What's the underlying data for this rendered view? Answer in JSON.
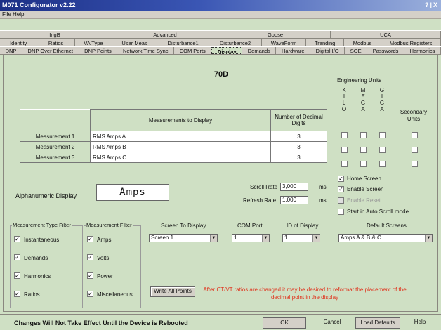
{
  "window": {
    "title": "M071 Configurator v2.22",
    "controls": "?|X"
  },
  "menu": [
    "File",
    "Help"
  ],
  "tabs_row1": [
    "IrigB",
    "Advanced",
    "Goose",
    "UCA"
  ],
  "tabs_row2": [
    "Identity",
    "Ratios",
    "VA Type",
    "User Meas",
    "Disturbance1",
    "Disturbance2",
    "WaveForm",
    "Trending",
    "Modbus",
    "Modbus Registers"
  ],
  "tabs_row3": [
    "DNP",
    "DNP Over Ethernet",
    "DNP Points",
    "Network Time Sync",
    "COM Ports",
    "Display",
    "Demands",
    "Hardware",
    "Digital I/O",
    "SOE",
    "Passwords",
    "Harmonics"
  ],
  "active_tab": "Display",
  "device_title": "70D",
  "engineering_units": {
    "title": "Engineering Units",
    "columns": [
      [
        "K",
        "I",
        "L",
        "O"
      ],
      [
        "M",
        "E",
        "G",
        "A"
      ],
      [
        "G",
        "I",
        "G",
        "A"
      ]
    ],
    "secondary_units_label": "Secondary Units"
  },
  "measurements_table": {
    "headers": [
      "Measurements to Display",
      "Number of Decimal Digits"
    ],
    "rows": [
      {
        "label": "Measurement 1",
        "value": "RMS Amps A",
        "digits": "3"
      },
      {
        "label": "Measurement 2",
        "value": "RMS Amps B",
        "digits": "3"
      },
      {
        "label": "Measurement 3",
        "value": "RMS Amps C",
        "digits": "3"
      }
    ]
  },
  "alphanumeric": {
    "label": "Alphanumeric Display",
    "value": "Amps"
  },
  "scroll_rate": {
    "label": "Scroll Rate",
    "value": "3,000",
    "unit": "ms"
  },
  "refresh_rate": {
    "label": "Refresh Rate",
    "value": "1,000",
    "unit": "ms"
  },
  "screen_options": [
    {
      "label": "Home Screen",
      "checked": true,
      "enabled": true
    },
    {
      "label": "Enable Screen",
      "checked": true,
      "enabled": true
    },
    {
      "label": "Enable Reset",
      "checked": false,
      "enabled": false
    },
    {
      "label": "Start in Auto Scroll mode",
      "checked": false,
      "enabled": true
    }
  ],
  "measurement_type_filter": {
    "title": "Measurement Type Filter",
    "items": [
      "Instantaneous",
      "Demands",
      "Harmonics",
      "Ratios"
    ]
  },
  "measurement_filter": {
    "title": "Measurement Filter",
    "items": [
      "Amps",
      "Volts",
      "Power",
      "Miscellaneous"
    ]
  },
  "screen_to_display": {
    "label": "Screen To Display",
    "value": "Screen 1"
  },
  "com_port": {
    "label": "COM Port",
    "value": "1"
  },
  "id_of_display": {
    "label": "ID of Display",
    "value": "1"
  },
  "default_screens": {
    "label": "Default Screens",
    "value": "Amps A & B & C"
  },
  "write_all_points": "Write All Points",
  "warning_message": "After CT/VT ratios are changed it may be desired to reformat the placement of the decimal point in the display",
  "status_text": "Changes Will Not Take Effect Until the Device is Rebooted",
  "buttons": {
    "ok": "OK",
    "cancel": "Cancel",
    "load_defaults": "Load Defaults",
    "help": "Help"
  },
  "check_glyph": "✓"
}
